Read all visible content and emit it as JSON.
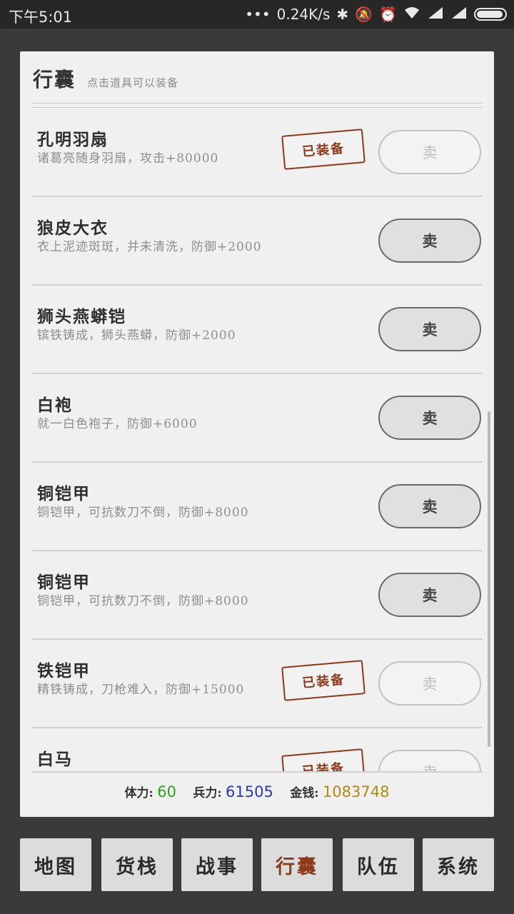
{
  "status_bar": {
    "time": "下午5:01",
    "dots": "•••",
    "net_speed": "0.24K/s",
    "icons": [
      "bluetooth-icon",
      "mute-icon",
      "alarm-icon",
      "wifi-icon",
      "signal-icon",
      "signal-icon-2",
      "battery-icon"
    ]
  },
  "panel": {
    "title": "行囊",
    "hint": "点击道具可以装备"
  },
  "items": [
    {
      "name": "孔明羽扇",
      "desc": "诸葛亮随身羽扇，攻击+80000",
      "equipped": true,
      "stamp": "已装备",
      "sell_label": "卖"
    },
    {
      "name": "狼皮大衣",
      "desc": "衣上泥迹斑斑，并未清洗，防御+2000",
      "equipped": false,
      "stamp": "",
      "sell_label": "卖"
    },
    {
      "name": "狮头燕蟒铠",
      "desc": "镔铁铸成，狮头燕蟒，防御+2000",
      "equipped": false,
      "stamp": "",
      "sell_label": "卖"
    },
    {
      "name": "白袍",
      "desc": "就一白色袍子，防御+6000",
      "equipped": false,
      "stamp": "",
      "sell_label": "卖"
    },
    {
      "name": "铜铠甲",
      "desc": "铜铠甲，可抗数刀不倒，防御+8000",
      "equipped": false,
      "stamp": "",
      "sell_label": "卖"
    },
    {
      "name": "铜铠甲",
      "desc": "铜铠甲，可抗数刀不倒，防御+8000",
      "equipped": false,
      "stamp": "",
      "sell_label": "卖"
    },
    {
      "name": "铁铠甲",
      "desc": "精铁铸成，刀枪难入，防御+15000",
      "equipped": true,
      "stamp": "已装备",
      "sell_label": "卖"
    },
    {
      "name": "白马",
      "desc": "",
      "equipped": true,
      "stamp": "已装备",
      "sell_label": "卖"
    }
  ],
  "stats": {
    "stamina_label": "体力:",
    "stamina": "60",
    "stamina_color": "#2e9e1e",
    "troops_label": "兵力:",
    "troops": "61505",
    "troops_color": "#2b3aa8",
    "gold_label": "金钱:",
    "gold": "1083748",
    "gold_color": "#b08a10"
  },
  "nav": [
    {
      "label": "地图",
      "active": false
    },
    {
      "label": "货栈",
      "active": false
    },
    {
      "label": "战事",
      "active": false
    },
    {
      "label": "行囊",
      "active": true
    },
    {
      "label": "队伍",
      "active": false
    },
    {
      "label": "系统",
      "active": false
    }
  ],
  "colors": {
    "background": "#3a3a3a",
    "panel": "#f0f0f0",
    "stamp": "#8b3a1c",
    "active_nav": "#8b3a1c"
  }
}
